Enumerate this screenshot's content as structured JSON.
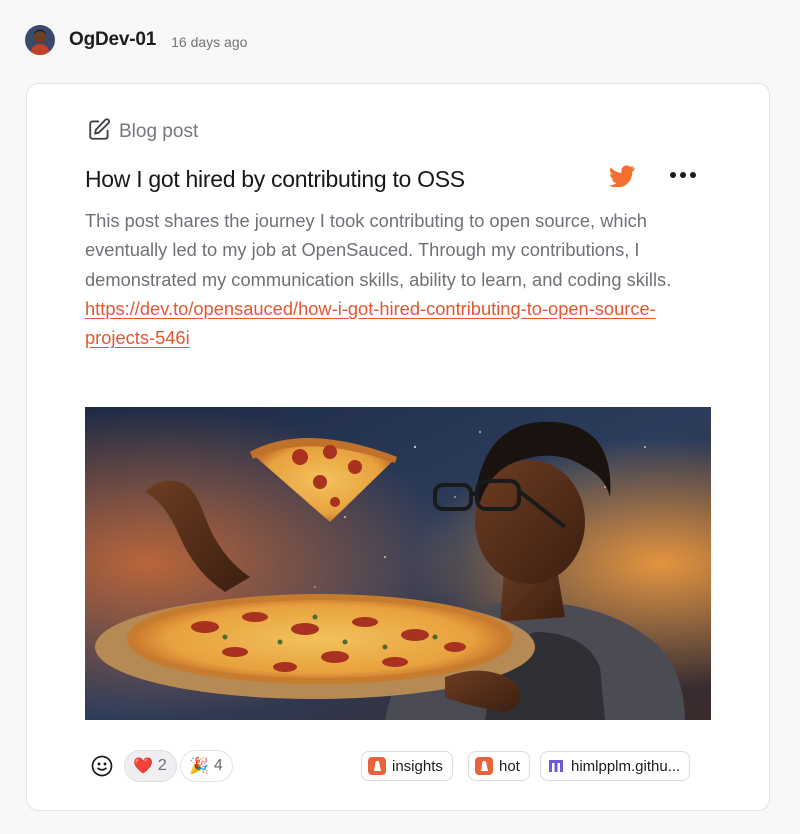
{
  "post": {
    "username": "OgDev-01",
    "time_ago": "16 days ago",
    "kind_label": "Blog post",
    "title": "How I got hired by contributing to OSS",
    "description": "This post shares the journey I took contributing to open source, which eventually led to my job at OpenSauced. Through my contributions, I demonstrated my communication skills, ability to learn, and coding skills.",
    "link_text": "https://dev.to/opensauced/how-i-got-hired-contributing-to-open-source-projects-546i"
  },
  "reactions": [
    {
      "emoji": "❤️",
      "count": "2",
      "active": true
    },
    {
      "emoji": "🎉",
      "count": "4",
      "active": false
    }
  ],
  "tags": [
    {
      "label": "insights",
      "icon": "opensauced-icon"
    },
    {
      "label": "hot",
      "icon": "opensauced-icon"
    },
    {
      "label": "himlpplm.githu...",
      "icon": "repo-m-icon"
    }
  ],
  "colors": {
    "accent": "#e4572e",
    "twitter": "#f46f2e",
    "tag_icon": "#e8633a"
  },
  "icons": {
    "kind": "pencil-square-icon",
    "share": "twitter-icon",
    "menu": "more-dots-icon",
    "add_reaction": "smiley-icon"
  }
}
